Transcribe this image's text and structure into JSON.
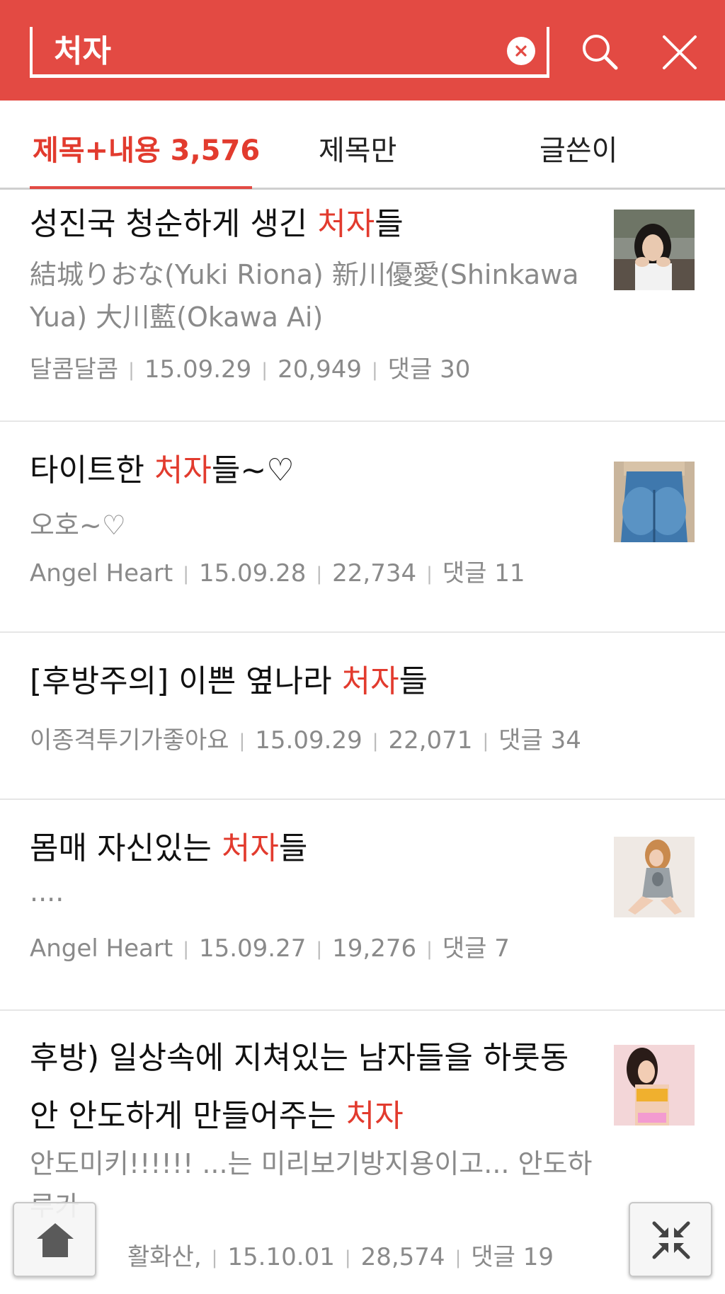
{
  "search": {
    "value": "처자"
  },
  "tabs": [
    {
      "label": "제목+내용 3,576",
      "active": true
    },
    {
      "label": "제목만",
      "active": false
    },
    {
      "label": "글쓴이",
      "active": false
    }
  ],
  "colors": {
    "accent": "#e34a43",
    "highlight": "#e23b2e"
  },
  "results": [
    {
      "title_pre": "성진국 청순하게 생긴 ",
      "title_hl": "처자",
      "title_post": "들",
      "snippet": "結城りおな(Yuki Riona) 新川優愛(Shinkawa Yua) 大川藍(Okawa Ai)",
      "author": "달콤달콤",
      "date": "15.09.29",
      "views": "20,949",
      "comments": "댓글 30",
      "thumb": "portrait-photo"
    },
    {
      "title_pre": "타이트한 ",
      "title_hl": "처자",
      "title_post": "들~♡",
      "snippet": "오호~♡",
      "author": "Angel Heart",
      "date": "15.09.28",
      "views": "22,734",
      "comments": "댓글 11",
      "thumb": "jeans-photo"
    },
    {
      "title_pre": "[후방주의] 이쁜 옆나라 ",
      "title_hl": "처자",
      "title_post": "들",
      "snippet": "",
      "author": "이종격투기가좋아요",
      "date": "15.09.29",
      "views": "22,071",
      "comments": "댓글 34",
      "thumb": ""
    },
    {
      "title_pre": "몸매 자신있는 ",
      "title_hl": "처자",
      "title_post": "들",
      "snippet": "....",
      "author": "Angel Heart",
      "date": "15.09.27",
      "views": "19,276",
      "comments": "댓글 7",
      "thumb": "model-photo"
    },
    {
      "title_pre": "후방) 일상속에 지쳐있는 남자들을 하룻동안 안도하게 만들어주는 ",
      "title_hl": "처자",
      "title_post": "",
      "snippet": "안도미키!!!!!! ...는 미리보기방지용이고... 안도하루카",
      "author": "활화산,",
      "date": "15.10.01",
      "views": "28,574",
      "comments": "댓글 19",
      "thumb": "bikini-photo"
    }
  ]
}
